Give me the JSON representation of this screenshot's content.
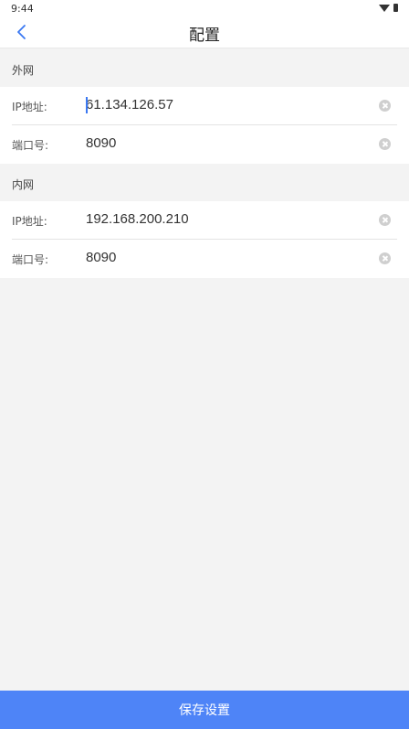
{
  "status_bar": {
    "time": "9:44"
  },
  "navbar": {
    "title": "配置",
    "back_icon": "chevron-left-icon"
  },
  "external": {
    "section_title": "外网",
    "ip_label": "IP地址:",
    "ip_value": "61.134.126.57",
    "port_label": "端口号:",
    "port_value": "8090"
  },
  "internal": {
    "section_title": "内网",
    "ip_label": "IP地址:",
    "ip_value": "192.168.200.210",
    "port_label": "端口号:",
    "port_value": "8090"
  },
  "footer": {
    "save_label": "保存设置"
  },
  "colors": {
    "accent": "#4e84f7",
    "background": "#f3f3f3"
  }
}
